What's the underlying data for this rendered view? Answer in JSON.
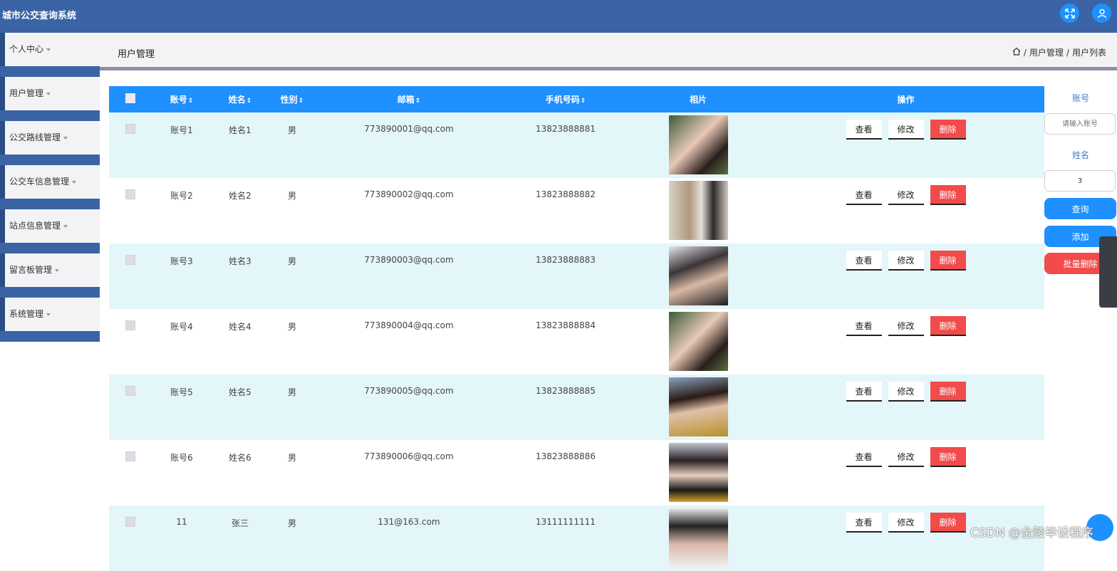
{
  "app": {
    "title": "城市公交查询系统"
  },
  "topbar": {
    "icons": [
      "fullscreen-icon",
      "user-icon"
    ],
    "accent": "#1e90ff",
    "bg": "#3a64a5"
  },
  "sidebar": {
    "items": [
      {
        "label": "个人中心"
      },
      {
        "label": "用户管理"
      },
      {
        "label": "公交路线管理"
      },
      {
        "label": "公交车信息管理"
      },
      {
        "label": "站点信息管理"
      },
      {
        "label": "留言板管理"
      },
      {
        "label": "系统管理"
      }
    ]
  },
  "header": {
    "title": "用户管理",
    "breadcrumb": {
      "home_icon": "home-icon",
      "sep1": "/",
      "item1": "用户管理",
      "sep2": "/",
      "item2": "用户列表"
    }
  },
  "table": {
    "columns": {
      "account": "账号",
      "name": "姓名",
      "gender": "性别",
      "email": "邮箱",
      "phone": "手机号码",
      "photo": "相片",
      "ops": "操作"
    },
    "sort_icon": "⇕",
    "rows": [
      {
        "account": "账号1",
        "name": "姓名1",
        "gender": "男",
        "email": "773890001@qq.com",
        "phone": "13823888881"
      },
      {
        "account": "账号2",
        "name": "姓名2",
        "gender": "男",
        "email": "773890002@qq.com",
        "phone": "13823888882"
      },
      {
        "account": "账号3",
        "name": "姓名3",
        "gender": "男",
        "email": "773890003@qq.com",
        "phone": "13823888883"
      },
      {
        "account": "账号4",
        "name": "姓名4",
        "gender": "男",
        "email": "773890004@qq.com",
        "phone": "13823888884"
      },
      {
        "account": "账号5",
        "name": "姓名5",
        "gender": "男",
        "email": "773890005@qq.com",
        "phone": "13823888885"
      },
      {
        "account": "账号6",
        "name": "姓名6",
        "gender": "男",
        "email": "773890006@qq.com",
        "phone": "13823888886"
      },
      {
        "account": "11",
        "name": "张三",
        "gender": "男",
        "email": "131@163.com",
        "phone": "13111111111"
      }
    ],
    "actions": {
      "view": "查看",
      "edit": "修改",
      "delete": "删除"
    }
  },
  "search": {
    "account_label": "账号",
    "account_placeholder": "请输入账号",
    "name_label": "姓名",
    "name_value": "3",
    "query_button": "查询",
    "add_button": "添加",
    "batch_delete_button": "批量删除"
  },
  "watermark": "CSDN @金陵毕设程序",
  "colors": {
    "primary": "#1e90ff",
    "danger": "#f14b4b",
    "row_alt": "#e3f6f9"
  }
}
